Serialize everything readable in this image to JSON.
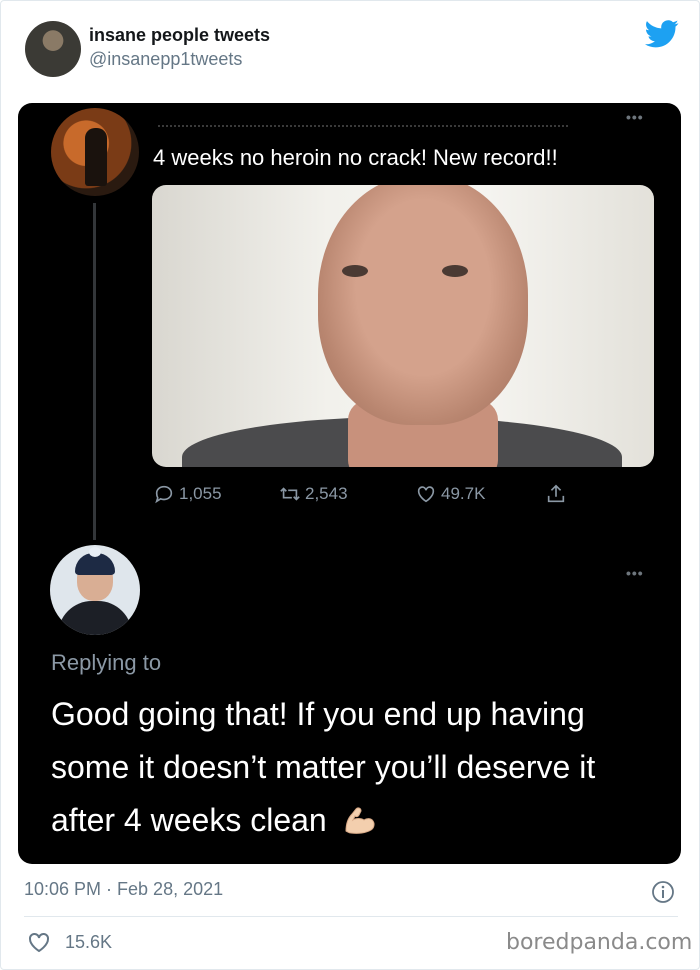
{
  "header": {
    "display_name": "insane people tweets",
    "handle": "@insanepp1tweets"
  },
  "embedded": {
    "original_tweet": {
      "text": "4 weeks no heroin no crack! New record!!",
      "replies": "1,055",
      "retweets": "2,543",
      "likes": "49.7K"
    },
    "reply": {
      "replying_to_label": "Replying to",
      "text": "Good going that! If you end up having some it doesn’t matter you’ll deserve it after 4 weeks clean"
    },
    "more_icon": "•••"
  },
  "footer": {
    "timestamp": "10:06 PM · Feb 28, 2021",
    "likes": "15.6K"
  },
  "watermark": "boredpanda.com",
  "colors": {
    "twitter_blue": "#1da1f2",
    "embed_bg": "#000000",
    "muted": "#657786"
  },
  "icons": [
    "twitter-bird-icon",
    "reply-icon",
    "retweet-icon",
    "like-icon",
    "share-icon",
    "info-icon",
    "heart-icon",
    "flexed-biceps-emoji"
  ]
}
